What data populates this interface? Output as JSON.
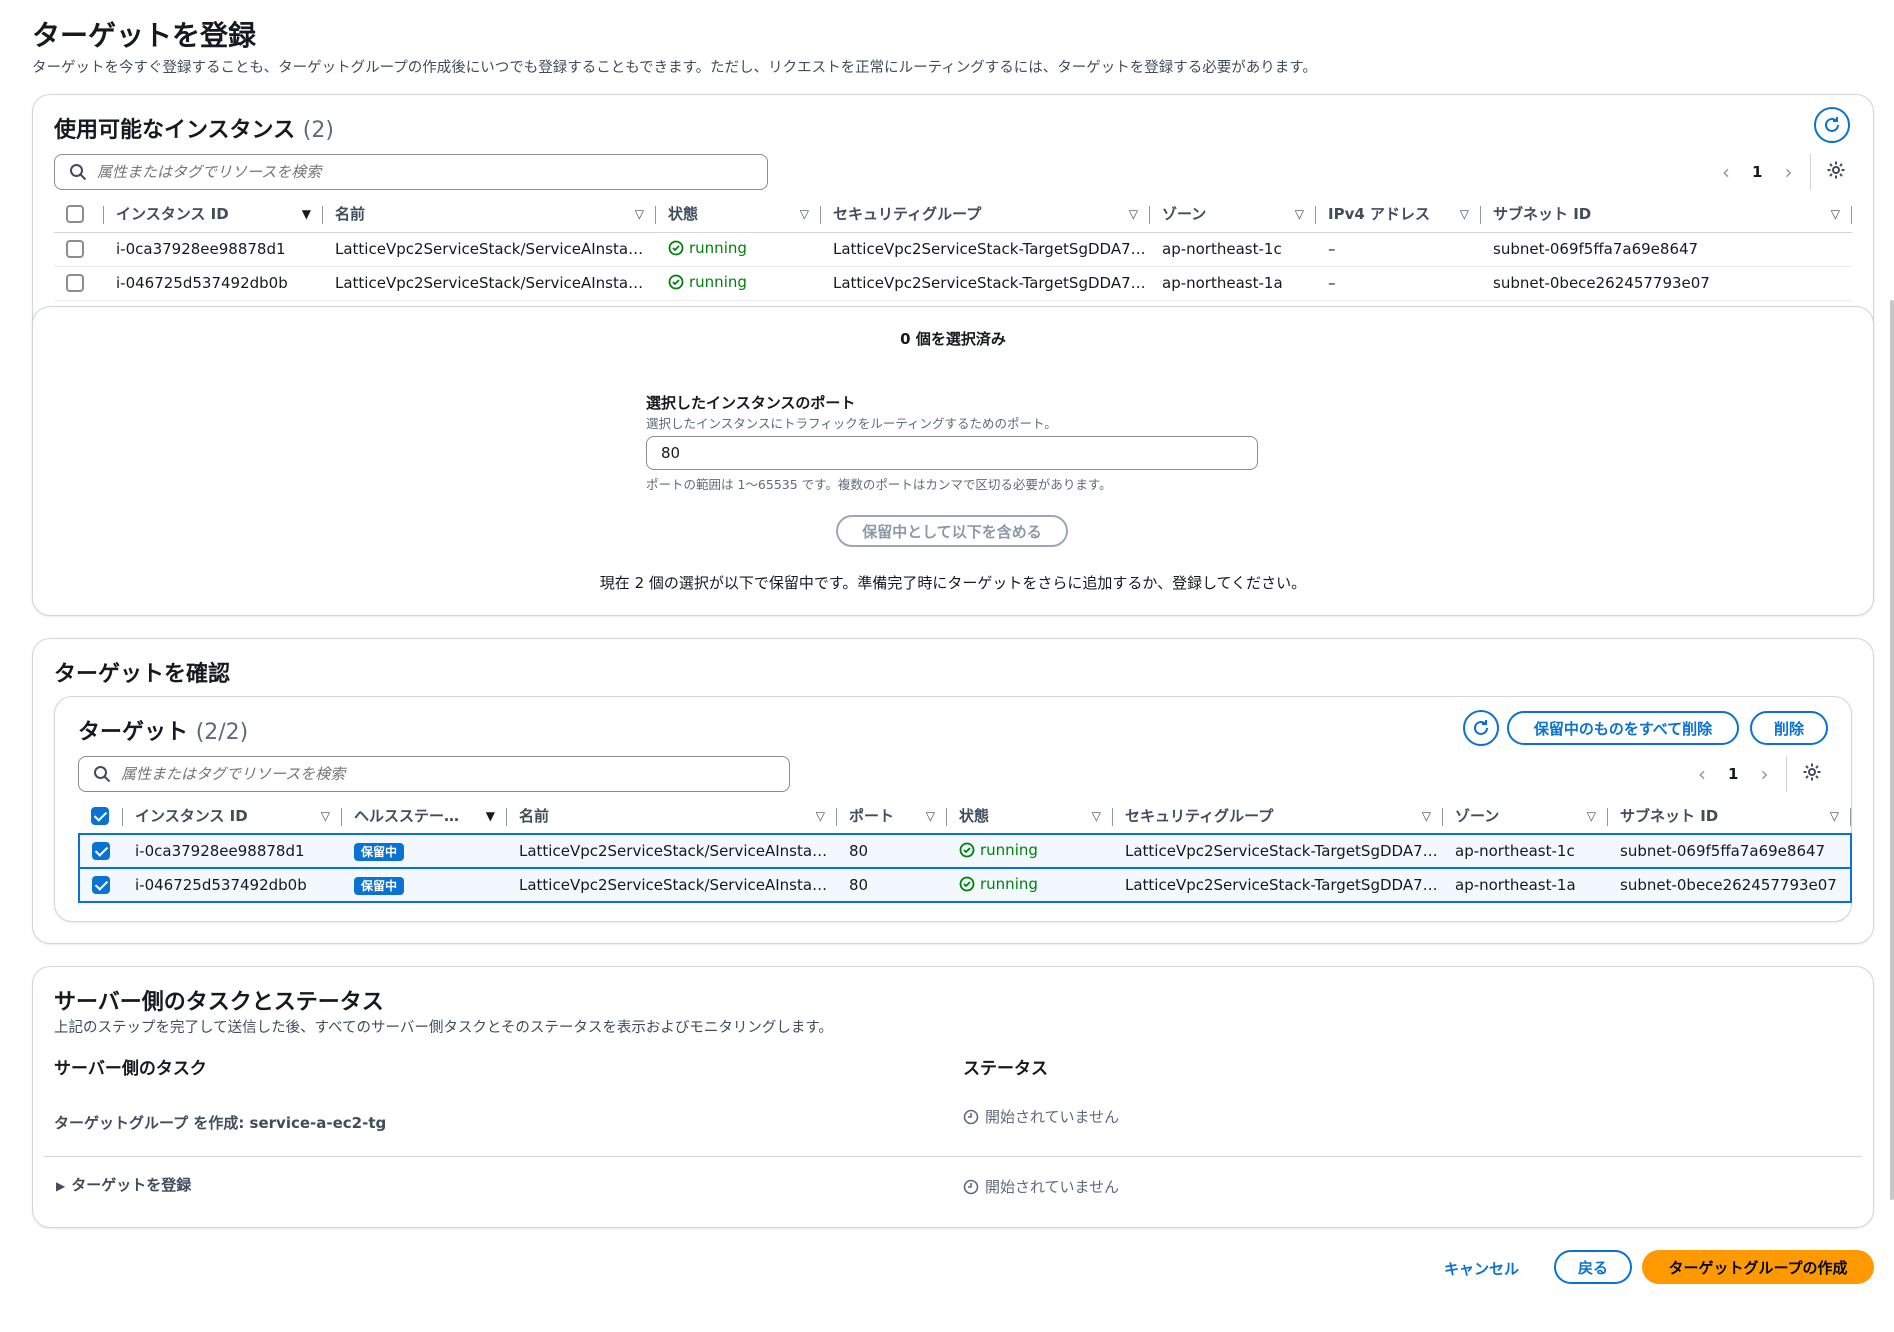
{
  "page": {
    "title": "ターゲットを登録",
    "description": "ターゲットを今すぐ登録することも、ターゲットグループの作成後にいつでも登録することもできます。ただし、リクエストを正常にルーティングするには、ターゲットを登録する必要があります。"
  },
  "available": {
    "title": "使用可能なインスタンス",
    "count": "(2)",
    "search_placeholder": "属性またはタグでリソースを検索",
    "page_number": "1",
    "columns": [
      "インスタンス ID",
      "名前",
      "状態",
      "セキュリティグループ",
      "ゾーン",
      "IPv4 アドレス",
      "サブネット ID"
    ],
    "rows": [
      {
        "id": "i-0ca37928ee98878d1",
        "name": "LatticeVpc2ServiceStack/ServiceAInsta…",
        "state": "running",
        "sg": "LatticeVpc2ServiceStack-TargetSgDDA7…",
        "zone": "ap-northeast-1c",
        "ipv4": "–",
        "subnet": "subnet-069f5ffa7a69e8647"
      },
      {
        "id": "i-046725d537492db0b",
        "name": "LatticeVpc2ServiceStack/ServiceAInsta…",
        "state": "running",
        "sg": "LatticeVpc2ServiceStack-TargetSgDDA7…",
        "zone": "ap-northeast-1a",
        "ipv4": "–",
        "subnet": "subnet-0bece262457793e07"
      }
    ]
  },
  "selection": {
    "selected_count": "0 個を選択済み",
    "port_label": "選択したインスタンスのポート",
    "port_desc": "選択したインスタンスにトラフィックをルーティングするためのポート。",
    "port_value": "80",
    "port_hint": "ポートの範囲は 1〜65535 です。複数のポートはカンマで区切る必要があります。",
    "include_button": "保留中として以下を含める",
    "pending_note": "現在 2 個の選択が以下で保留中です。準備完了時にターゲットをさらに追加するか、登録してください。"
  },
  "review": {
    "title": "ターゲットを確認",
    "targets_title": "ターゲット",
    "targets_count": "(2/2)",
    "remove_all_pending": "保留中のものをすべて削除",
    "remove": "削除",
    "search_placeholder": "属性またはタグでリソースを検索",
    "page_number": "1",
    "columns": [
      "インスタンス ID",
      "ヘルスステー…",
      "名前",
      "ポート",
      "状態",
      "セキュリティグループ",
      "ゾーン",
      "サブネット ID"
    ],
    "rows": [
      {
        "id": "i-0ca37928ee98878d1",
        "health": "保留中",
        "name": "LatticeVpc2ServiceStack/ServiceAInsta…",
        "port": "80",
        "state": "running",
        "sg": "LatticeVpc2ServiceStack-TargetSgDDA7…",
        "zone": "ap-northeast-1c",
        "subnet": "subnet-069f5ffa7a69e8647"
      },
      {
        "id": "i-046725d537492db0b",
        "health": "保留中",
        "name": "LatticeVpc2ServiceStack/ServiceAInsta…",
        "port": "80",
        "state": "running",
        "sg": "LatticeVpc2ServiceStack-TargetSgDDA7…",
        "zone": "ap-northeast-1a",
        "subnet": "subnet-0bece262457793e07"
      }
    ]
  },
  "server_tasks": {
    "title": "サーバー側のタスクとステータス",
    "description": "上記のステップを完了して送信した後、すべてのサーバー側タスクとそのステータスを表示およびモニタリングします。",
    "col_task": "サーバー側のタスク",
    "col_status": "ステータス",
    "tasks": [
      {
        "label": "ターゲットグループ を作成: service-a-ec2-tg",
        "status": "開始されていません"
      },
      {
        "label": "ターゲットを登録",
        "status": "開始されていません"
      }
    ]
  },
  "footer": {
    "cancel": "キャンセル",
    "back": "戻る",
    "create": "ターゲットグループの作成"
  },
  "colors": {
    "accent": "#0972d3",
    "primary": "#ff9900",
    "success": "#037f0c"
  }
}
